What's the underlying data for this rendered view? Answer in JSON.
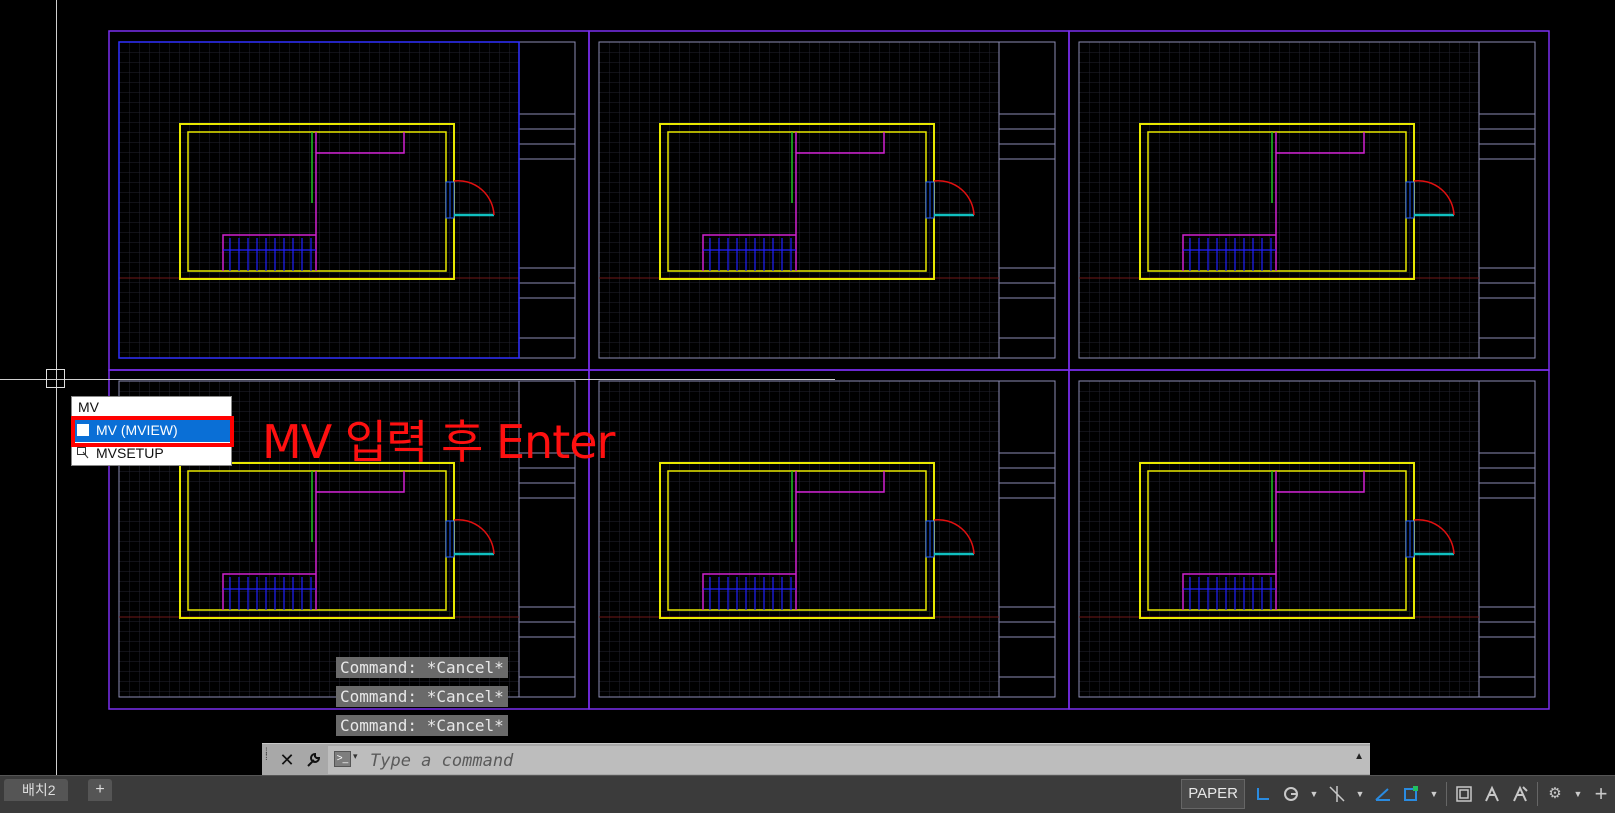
{
  "drawing": {
    "colors": {
      "background": "#000000",
      "viewport_border": "#7b2ff0",
      "sheet_border": "#8c8cb4",
      "wall": "#e8e800",
      "partition": "#d020d0",
      "green_wall": "#20c020",
      "stairs": "#2020ff",
      "door_arc": "#e01010",
      "door_frame": "#10c0c0",
      "grid": "#2a2a3a",
      "axis_red": "#701818"
    }
  },
  "autocomplete": {
    "input_text": "MV",
    "items": [
      {
        "label": "MV (MVIEW)",
        "icon": "mview-icon",
        "selected": true
      },
      {
        "label": "MVSETUP",
        "icon": "mvsetup-icon",
        "selected": false
      }
    ]
  },
  "annotation": {
    "text": "MV 입력 후 Enter",
    "color": "#ff1010"
  },
  "command_history": [
    "Command: *Cancel*",
    "Command: *Cancel*",
    "Command: *Cancel*"
  ],
  "command_line": {
    "placeholder": "Type a command",
    "close_icon": "close-icon",
    "customize_icon": "wrench-icon",
    "prompt_icon": "command-prompt-icon"
  },
  "layout_tabs": {
    "tabs": [
      {
        "label": "배치2"
      }
    ],
    "add_label": "+"
  },
  "status_bar": {
    "space_label": "PAPER",
    "icons": [
      "grid-icon",
      "ucs-icon",
      "polar-icon",
      "caret-down-icon",
      "osnap-track-icon",
      "caret-down-icon",
      "isodraft-icon",
      "osnap-icon",
      "caret-down-icon",
      "viewport-scale-icon",
      "annotation-monitor-icon",
      "annotation-visibility-icon",
      "gear-icon",
      "caret-down-icon",
      "customize-plus-icon"
    ]
  }
}
